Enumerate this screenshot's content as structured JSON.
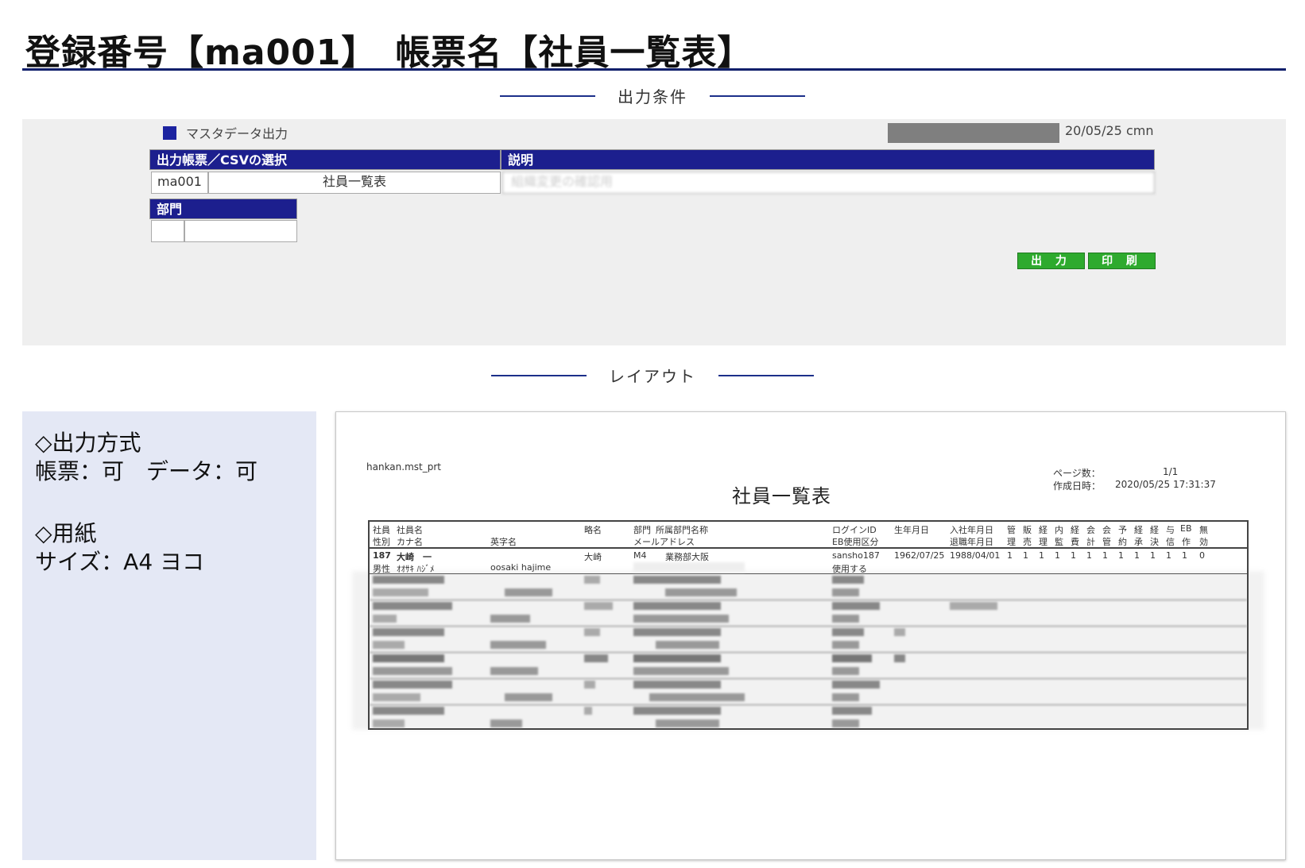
{
  "header": {
    "title": "登録番号【ma001】　帳票名【社員一覧表】"
  },
  "sections": {
    "conditions": "出力条件",
    "layout": "レイアウト"
  },
  "conditions": {
    "master_label": "マスタデータ出力",
    "stamp": "20/05/25 cmn",
    "table_head": {
      "select": "出力帳票／CSVの選択",
      "desc": "説明"
    },
    "row": {
      "code": "ma001",
      "name": "社員一覧表",
      "desc": "組織変更の確認用"
    },
    "dept_head": "部門",
    "buttons": {
      "output": "出 力",
      "print": "印 刷"
    }
  },
  "left_panel": {
    "output_title": "◇出力方式",
    "output_value": "帳票：可　データ：可",
    "paper_title": "◇用紙",
    "paper_value": "サイズ：A4 ヨコ"
  },
  "preview": {
    "prt_name": "hankan.mst_prt",
    "title": "社員一覧表",
    "page_label": "ページ数：",
    "page_value": "1/1",
    "date_label": "作成日時：",
    "date_value": "2020/05/25 17:31:37",
    "header_row1": [
      "社員",
      "社員名",
      "略名",
      "部門",
      "所属部門名称",
      "ログインID",
      "生年月日",
      "入社年月日",
      "管",
      "販",
      "経",
      "内",
      "経",
      "会",
      "会",
      "予",
      "経",
      "経",
      "与",
      "EB",
      "無"
    ],
    "header_row2": [
      "性別",
      "カナ名",
      "英字名",
      "メールアドレス",
      "EB使用区分",
      "退職年月日",
      "理",
      "売",
      "理",
      "監",
      "費",
      "計",
      "管",
      "約",
      "承",
      "決",
      "信",
      "作",
      "効"
    ],
    "first_row": {
      "id": "187",
      "name": "大崎　一",
      "short": "大崎",
      "dept": "M4",
      "dept_name": "業務部大阪",
      "login": "sansho187",
      "birth": "1962/07/25",
      "joined": "1988/04/01",
      "flags": [
        "1",
        "1",
        "1",
        "1",
        "1",
        "1",
        "1",
        "1",
        "1",
        "1",
        "1",
        "1",
        "0"
      ],
      "gender": "男性",
      "kana": "ｵｵｻｷ ﾊｼﾞﾒ",
      "english": "oosaki hajime",
      "eb": "使用する"
    }
  }
}
